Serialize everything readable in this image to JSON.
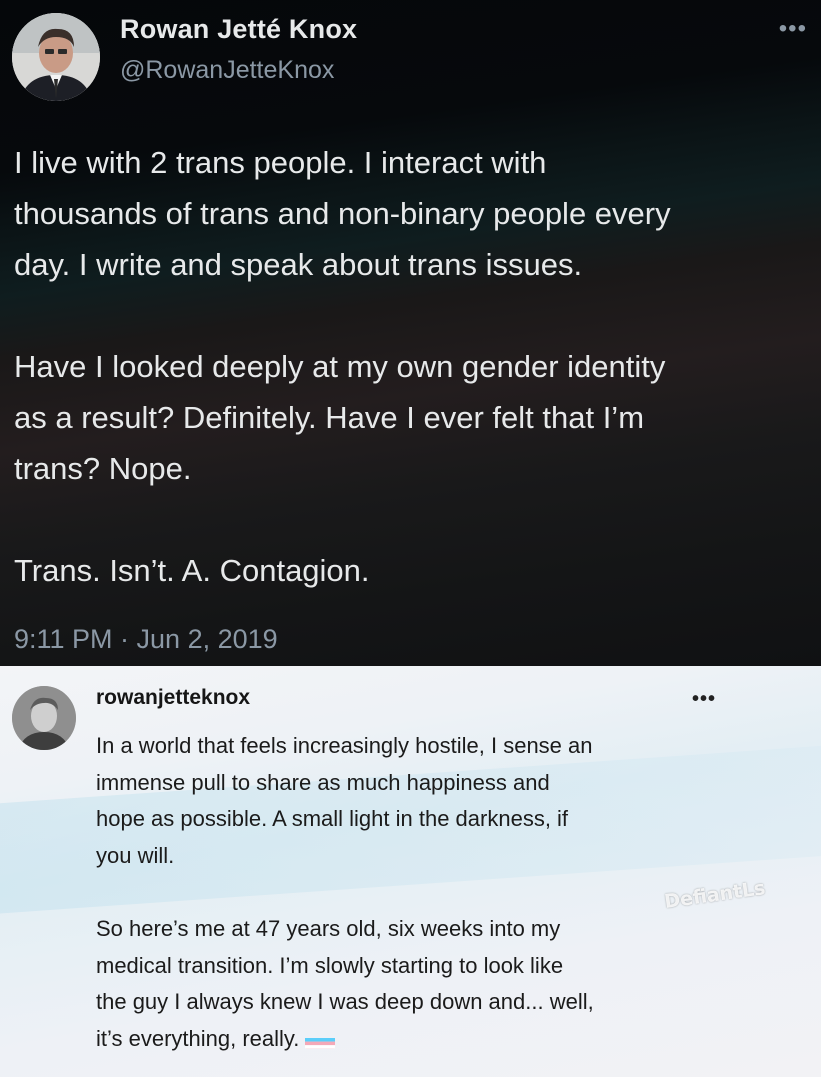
{
  "tweet": {
    "display_name": "Rowan Jetté Knox",
    "handle": "@RowanJetteKnox",
    "more_icon": "ellipsis-icon",
    "paragraphs": [
      "I live with 2 trans people. I interact with\nthousands of trans and non-binary people every\nday. I write and speak about trans issues.",
      "Have I looked deeply at my own gender identity\nas a result? Definitely. Have I ever felt that I’m\ntrans? Nope.",
      "Trans. Isn’t. A. Contagion."
    ],
    "timestamp": "9:11 PM · Jun 2, 2019",
    "colors": {
      "text": "#e7e9ea",
      "muted": "#8b98a5"
    }
  },
  "post": {
    "username": "rowanjetteknox",
    "more_icon": "ellipsis-icon",
    "paragraphs": [
      "In a world that feels increasingly hostile, I sense an\nimmense pull to share as much happiness and\nhope as possible. A small light in the darkness, if\nyou will.",
      "So here’s me at 47 years old, six weeks into my\nmedical transition. I’m slowly starting to look like\nthe guy I always knew I was deep down and... well,\nit’s everything, really."
    ],
    "emoji": "transgender-flag-icon",
    "watermark": "DefiantLs"
  }
}
